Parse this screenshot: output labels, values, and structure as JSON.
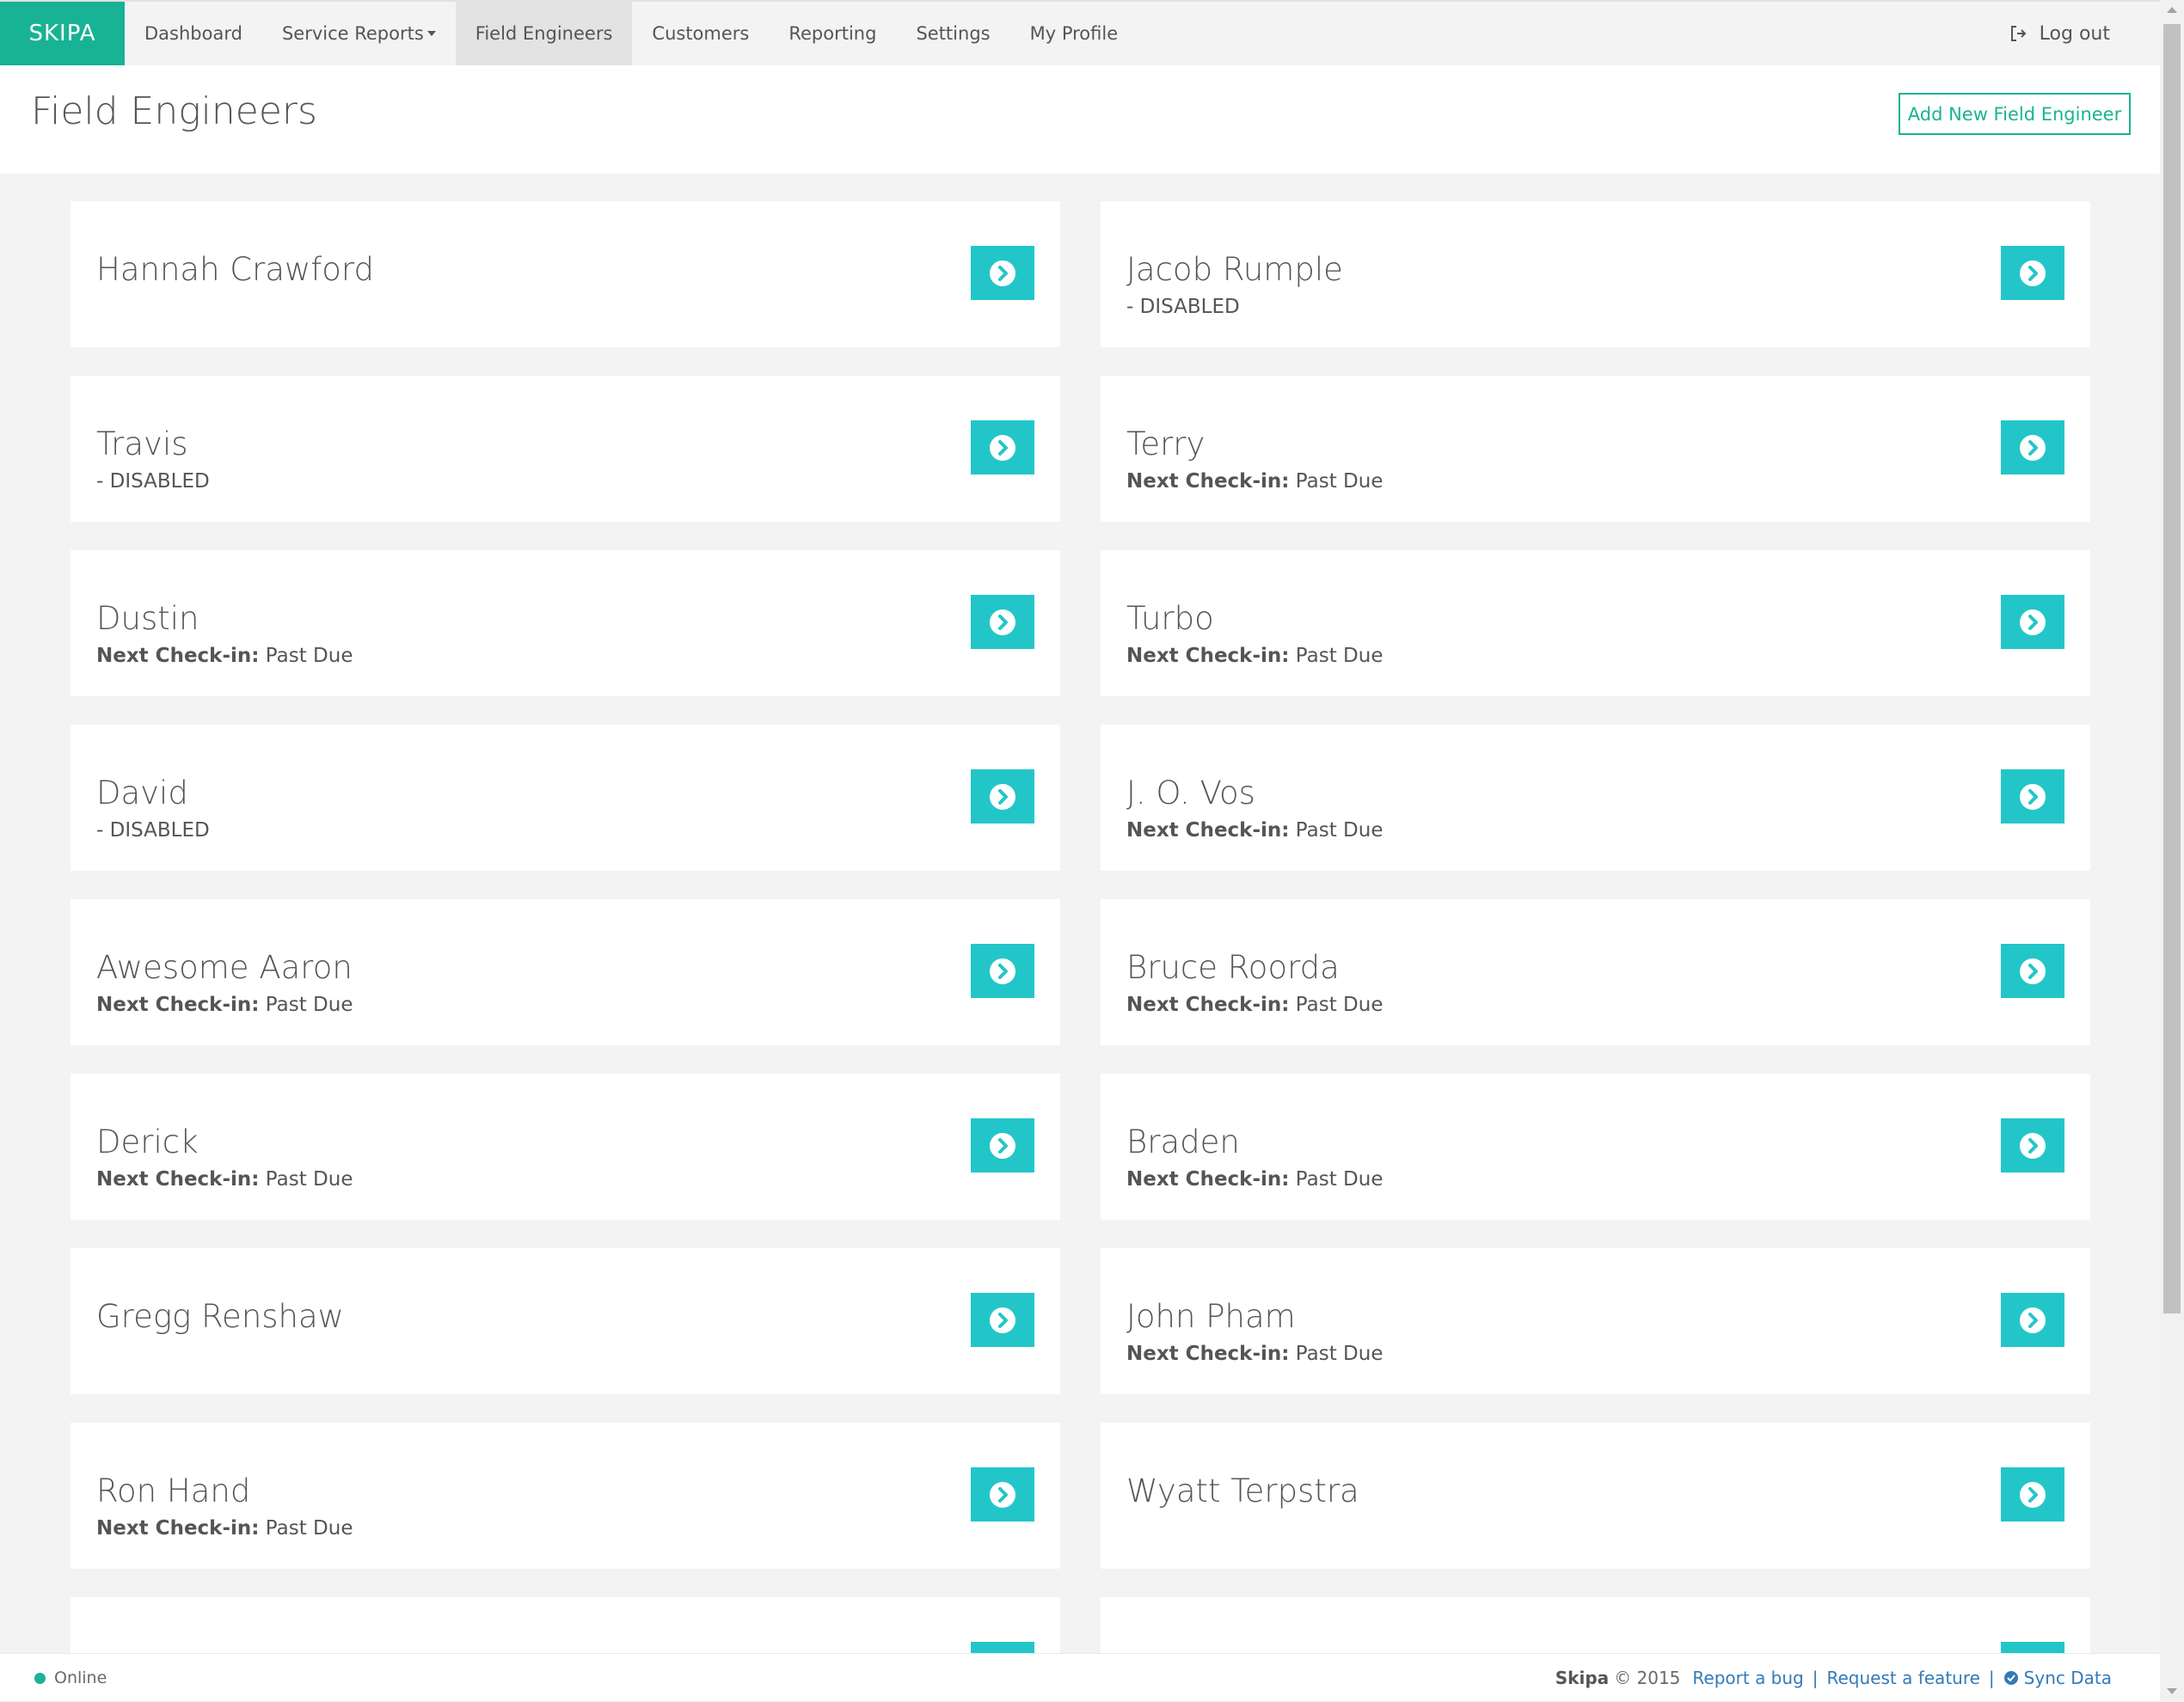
{
  "brand": "SKIPA",
  "nav": {
    "items": [
      "Dashboard",
      "Service Reports",
      "Field Engineers",
      "Customers",
      "Reporting",
      "Settings",
      "My Profile"
    ],
    "logout": "Log out"
  },
  "header": {
    "title": "Field Engineers",
    "add_button": "Add New Field Engineer"
  },
  "checkin_label": "Next Check-in:",
  "engineers": [
    {
      "name": "Hannah Crawford",
      "status": ""
    },
    {
      "name": "Jacob Rumple",
      "status": "- DISABLED"
    },
    {
      "name": "Travis",
      "status": "- DISABLED"
    },
    {
      "name": "Terry",
      "status": "Past Due",
      "checkin": true
    },
    {
      "name": "Dustin",
      "status": "Past Due",
      "checkin": true
    },
    {
      "name": "Turbo",
      "status": "Past Due",
      "checkin": true
    },
    {
      "name": "David",
      "status": "- DISABLED"
    },
    {
      "name": "J. O. Vos",
      "status": "Past Due",
      "checkin": true
    },
    {
      "name": "Awesome Aaron",
      "status": "Past Due",
      "checkin": true
    },
    {
      "name": "Bruce Roorda",
      "status": "Past Due",
      "checkin": true
    },
    {
      "name": "Derick",
      "status": "Past Due",
      "checkin": true
    },
    {
      "name": "Braden",
      "status": "Past Due",
      "checkin": true
    },
    {
      "name": "Gregg Renshaw",
      "status": ""
    },
    {
      "name": "John Pham",
      "status": "Past Due",
      "checkin": true
    },
    {
      "name": "Ron Hand",
      "status": "Past Due",
      "checkin": true
    },
    {
      "name": "Wyatt Terpstra",
      "status": ""
    },
    {
      "name": "",
      "status": ""
    },
    {
      "name": "",
      "status": ""
    }
  ],
  "footer": {
    "status": "Online",
    "brand": "Skipa",
    "copyright": "© 2015",
    "links": [
      "Report a bug",
      "Request a feature",
      "Sync Data"
    ]
  },
  "colors": {
    "brand": "#18b294",
    "button": "#23c6c8",
    "link": "#337ab7"
  }
}
